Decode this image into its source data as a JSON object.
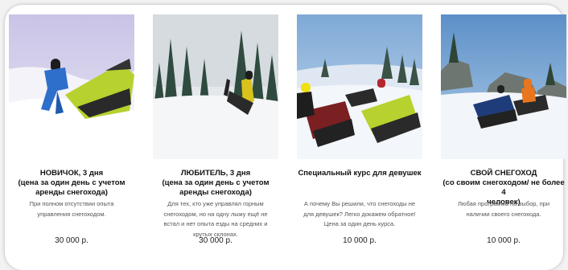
{
  "cards": [
    {
      "photo": "snowmobile-rider-deep-snow",
      "title": "НОВИЧОК, 3 дня\n(цена за один день с учетом\nаренды снегохода)",
      "description": "При полном отсутствии опыта\nуправления снегоходом.",
      "price": "30 000 р."
    },
    {
      "photo": "snowmobile-rider-forest-wheelie",
      "title": "ЛЮБИТЕЛЬ, 3 дня\n(цена за один день с учетом\nаренды снегохода)",
      "description": "Для тех, кто уже управлял горным\nснегоходом, но на одну лыжу ещё не\nвстал и нет опыта езды на средних и\nкрутых склонах.",
      "price": "30 000 р."
    },
    {
      "photo": "group-of-riders-on-snowmobiles",
      "title": "Специальный курс для девушек",
      "description": "А почему Вы решили, что снегоходы не\nдля девушек? Легко докажем обратное!\nЦена за один день курса.",
      "price": "10 000 р."
    },
    {
      "photo": "own-snowmobiles-group-rocks",
      "title": "СВОЙ СНЕГОХОД\n(со своим снегоходом/ не более 4\nчеловек)",
      "description": "Любая программа на выбор, при\nналичии своего снегохода.",
      "price": "10 000 р."
    }
  ]
}
